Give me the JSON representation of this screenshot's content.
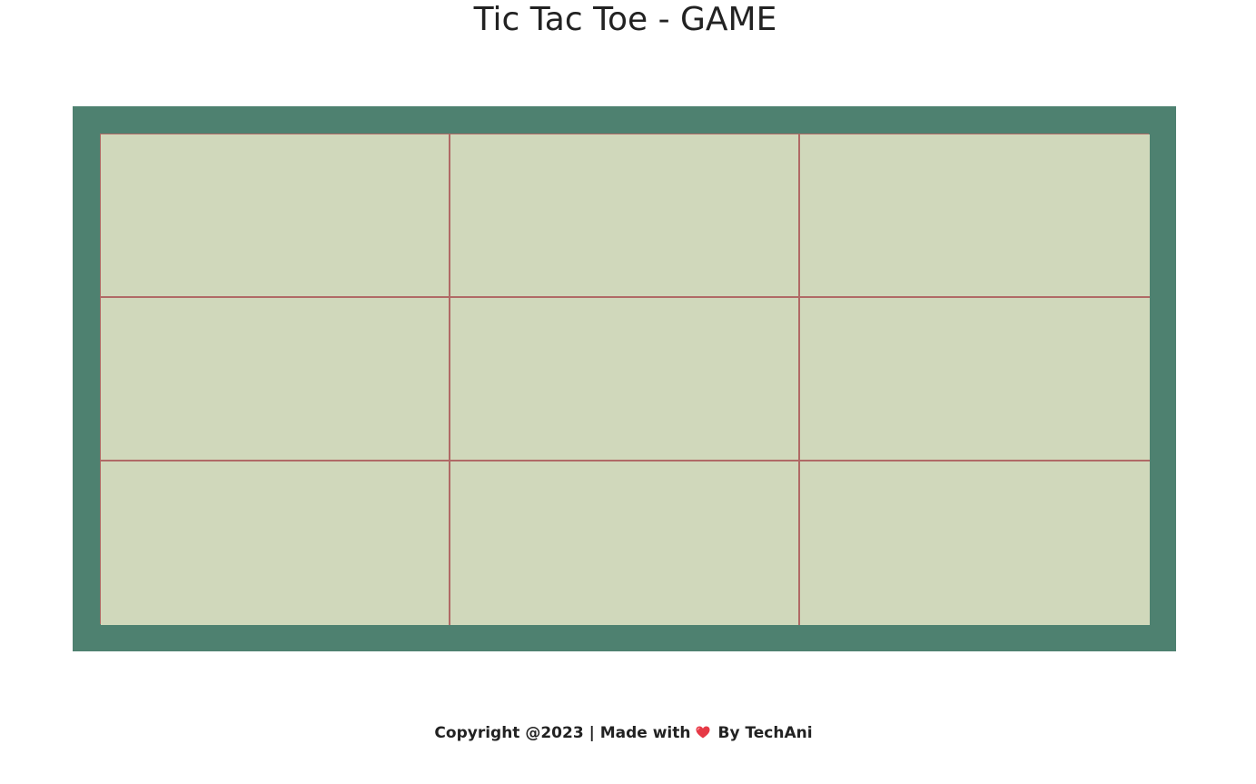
{
  "header": {
    "title": "Tic Tac Toe - GAME"
  },
  "board": {
    "frame_color": "#4e8170",
    "cell_color": "#d0d8bb",
    "line_color": "#b06a66",
    "cells": [
      "",
      "",
      "",
      "",
      "",
      "",
      "",
      "",
      ""
    ]
  },
  "footer": {
    "copyright_text": "Copyright @2023 | Made with",
    "heart_icon": "heart-icon",
    "heart_color": "#e63946",
    "author_text": "By TechAni"
  }
}
